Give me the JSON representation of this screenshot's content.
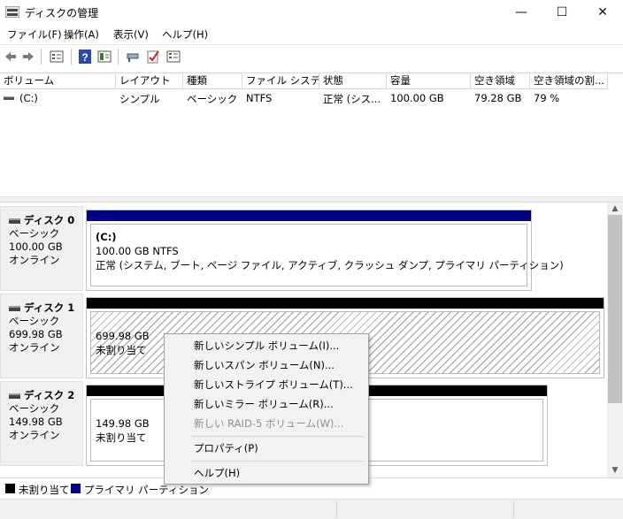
{
  "window": {
    "title": "ディスクの管理",
    "minimize_glyph": "—",
    "maximize_glyph": "☐",
    "close_glyph": "✕"
  },
  "menu": [
    "ファイル(F)",
    "操作(A)",
    "表示(V)",
    "ヘルプ(H)"
  ],
  "toolbar_icons": [
    "back-arrow-icon",
    "forward-arrow-icon",
    "properties-view-icon",
    "help-icon",
    "help-topics-icon",
    "connect-icon",
    "check-icon",
    "console-icon"
  ],
  "volume_list": {
    "columns": [
      "ボリューム",
      "レイアウト",
      "種類",
      "ファイル システム",
      "状態",
      "容量",
      "空き領域",
      "空き領域の割..."
    ],
    "rows": [
      {
        "volume": "(C:)",
        "layout": "シンプル",
        "type": "ベーシック",
        "fs": "NTFS",
        "status": "正常 (シス...",
        "capacity": "100.00 GB",
        "free": "79.28 GB",
        "free_pct": "79 %"
      }
    ]
  },
  "disks": [
    {
      "name": "ディスク 0",
      "kind": "ベーシック",
      "size": "100.00 GB",
      "state": "オンライン",
      "partition": {
        "label": "(C:)",
        "detail": "100.00 GB NTFS",
        "status": "正常 (システム, ブート, ページ ファイル, アクティブ, クラッシュ ダンプ, プライマリ パーティション)"
      }
    },
    {
      "name": "ディスク 1",
      "kind": "ベーシック",
      "size": "699.98 GB",
      "state": "オンライン",
      "partition": {
        "size": "699.98 GB",
        "status": "未割り当て"
      }
    },
    {
      "name": "ディスク 2",
      "kind": "ベーシック",
      "size": "149.98 GB",
      "state": "オンライン",
      "partition": {
        "size": "149.98 GB",
        "status": "未割り当て"
      }
    }
  ],
  "legend": {
    "unallocated": "未割り当て",
    "primary": "プライマリ パーティション"
  },
  "colors": {
    "primary_partition": "#000080",
    "unallocated": "#000000"
  },
  "context_menu": {
    "new_simple": "新しいシンプル ボリューム(I)...",
    "new_spanned": "新しいスパン ボリューム(N)...",
    "new_striped": "新しいストライプ ボリューム(T)...",
    "new_mirror": "新しいミラー ボリューム(R)...",
    "new_raid5": "新しい RAID-5 ボリューム(W)...",
    "properties": "プロパティ(P)",
    "help": "ヘルプ(H)"
  },
  "scrollbar": {
    "up_glyph": "▲",
    "down_glyph": "▼"
  }
}
